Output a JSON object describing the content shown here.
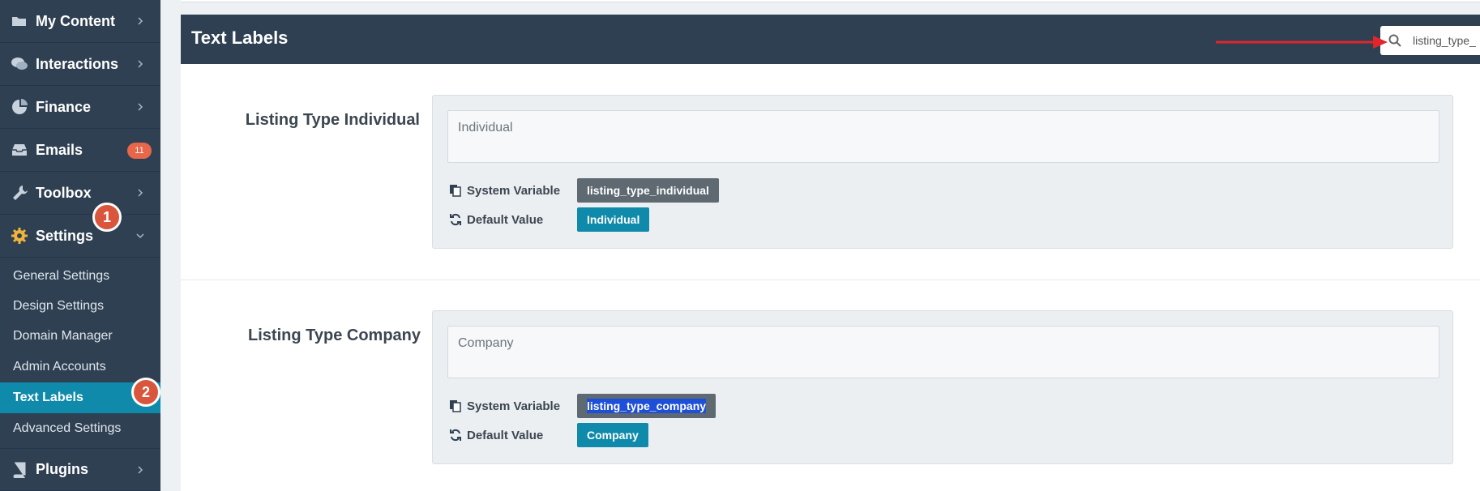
{
  "sidebar": {
    "items": [
      {
        "label": "My Content",
        "icon": "folder-icon"
      },
      {
        "label": "Interactions",
        "icon": "comments-icon"
      },
      {
        "label": "Finance",
        "icon": "pie-chart-icon"
      },
      {
        "label": "Emails",
        "icon": "inbox-icon",
        "badge": "11"
      },
      {
        "label": "Toolbox",
        "icon": "wrench-icon"
      },
      {
        "label": "Settings",
        "icon": "gear-icon"
      },
      {
        "label": "Plugins",
        "icon": "book-icon"
      }
    ],
    "settings_submenu": [
      {
        "label": "General Settings"
      },
      {
        "label": "Design Settings"
      },
      {
        "label": "Domain Manager"
      },
      {
        "label": "Admin Accounts"
      },
      {
        "label": "Text Labels"
      },
      {
        "label": "Advanced Settings"
      }
    ]
  },
  "steps": {
    "one": "1",
    "two": "2"
  },
  "panel": {
    "title": "Text Labels",
    "search_value": "listing_type_"
  },
  "fields": [
    {
      "label": "Listing Type Individual",
      "value": "Individual",
      "system_variable_label": "System Variable",
      "system_variable": "listing_type_individual",
      "default_value_label": "Default Value",
      "default_value": "Individual"
    },
    {
      "label": "Listing Type Company",
      "value": "Company",
      "system_variable_label": "System Variable",
      "system_variable": "listing_type_company",
      "default_value_label": "Default Value",
      "default_value": "Company"
    }
  ],
  "colors": {
    "sidebar_bg": "#2f4052",
    "accent": "#0f8aab",
    "badge": "#e8674a",
    "step_marker": "#d9563c",
    "arrow": "#e0262a"
  }
}
